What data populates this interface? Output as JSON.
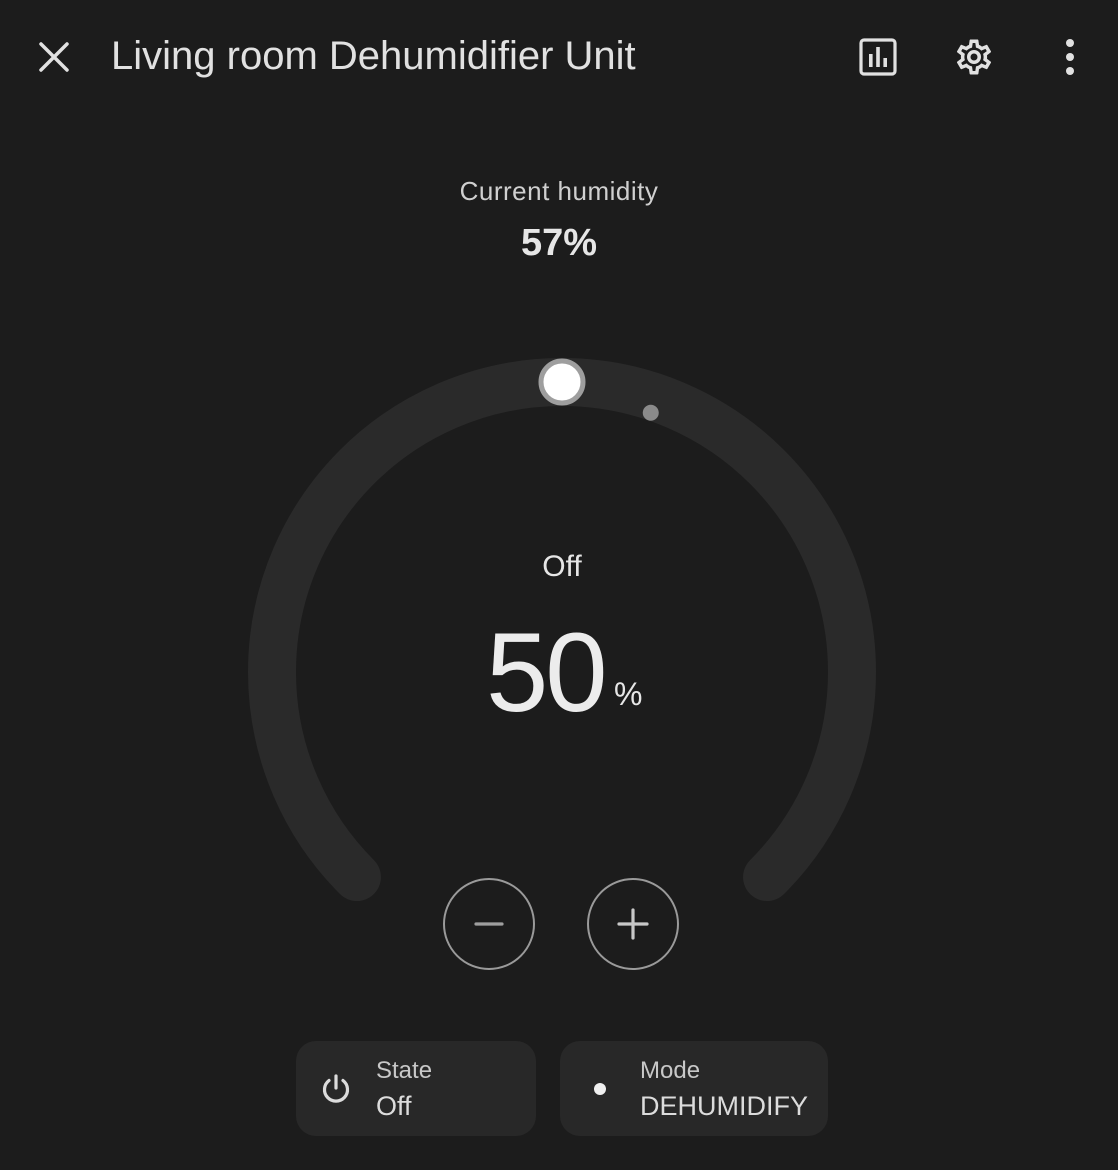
{
  "header": {
    "title": "Living room Dehumidifier Unit",
    "close_icon": "close-icon",
    "history_icon": "chart-bar-icon",
    "settings_icon": "gear-icon",
    "more_icon": "more-vertical-icon"
  },
  "current": {
    "label": "Current humidity",
    "value": "57%"
  },
  "dial": {
    "state": "Off",
    "target": "50",
    "unit": "%",
    "target_fraction": 0.5,
    "current_fraction": 0.57
  },
  "controls": {
    "minus_icon": "minus-icon",
    "plus_icon": "plus-icon"
  },
  "chips": {
    "state": {
      "label": "State",
      "value": "Off",
      "icon": "power-icon"
    },
    "mode": {
      "label": "Mode",
      "value": "DEHUMIDIFY",
      "icon": "dot-icon"
    }
  },
  "colors": {
    "background": "#1c1c1c",
    "track": "#2a2a2a",
    "text": "#e1e1e1",
    "knob": "#ffffff",
    "knob_ring": "#9e9e9e",
    "current_marker": "#8a8a8a"
  }
}
